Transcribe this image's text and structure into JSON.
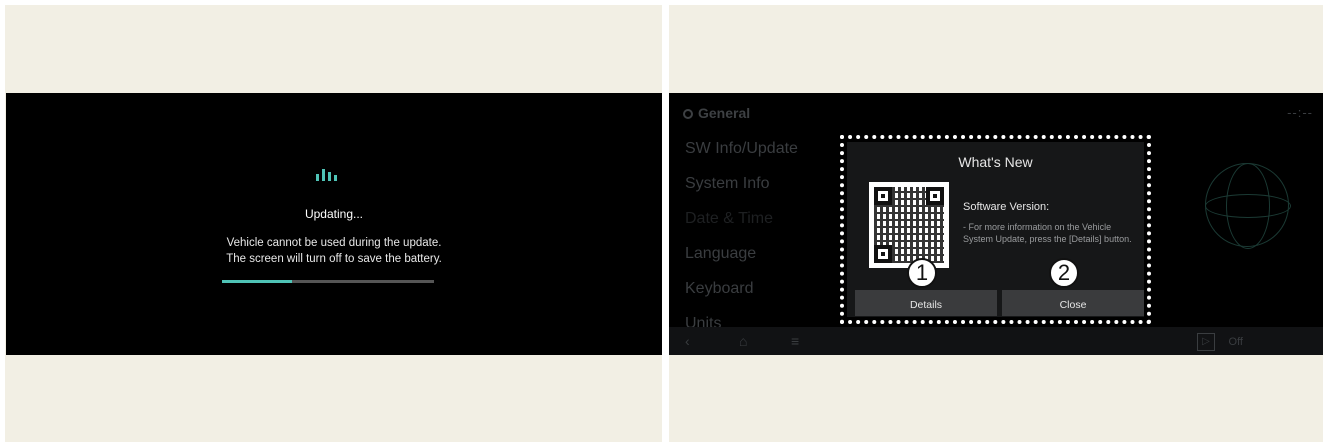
{
  "left_screen": {
    "title": "Updating...",
    "message_line1": "Vehicle cannot be used during the update.",
    "message_line2": "The screen will turn off to save the battery.",
    "progress": 0.33,
    "accent_color": "#4fc3b6"
  },
  "right_screen": {
    "header": "General",
    "clock": "--:--",
    "menu": [
      "SW Info/Update",
      "System Info",
      "Date & Time",
      "Language",
      "Keyboard",
      "Units"
    ],
    "media_label": "Off",
    "dialog": {
      "title": "What's New",
      "sw_label": "Software Version:",
      "description": "- For more information on the Vehicle System Update, press the [Details] button.",
      "details_label": "Details",
      "close_label": "Close"
    },
    "badges": [
      "1",
      "2"
    ]
  }
}
